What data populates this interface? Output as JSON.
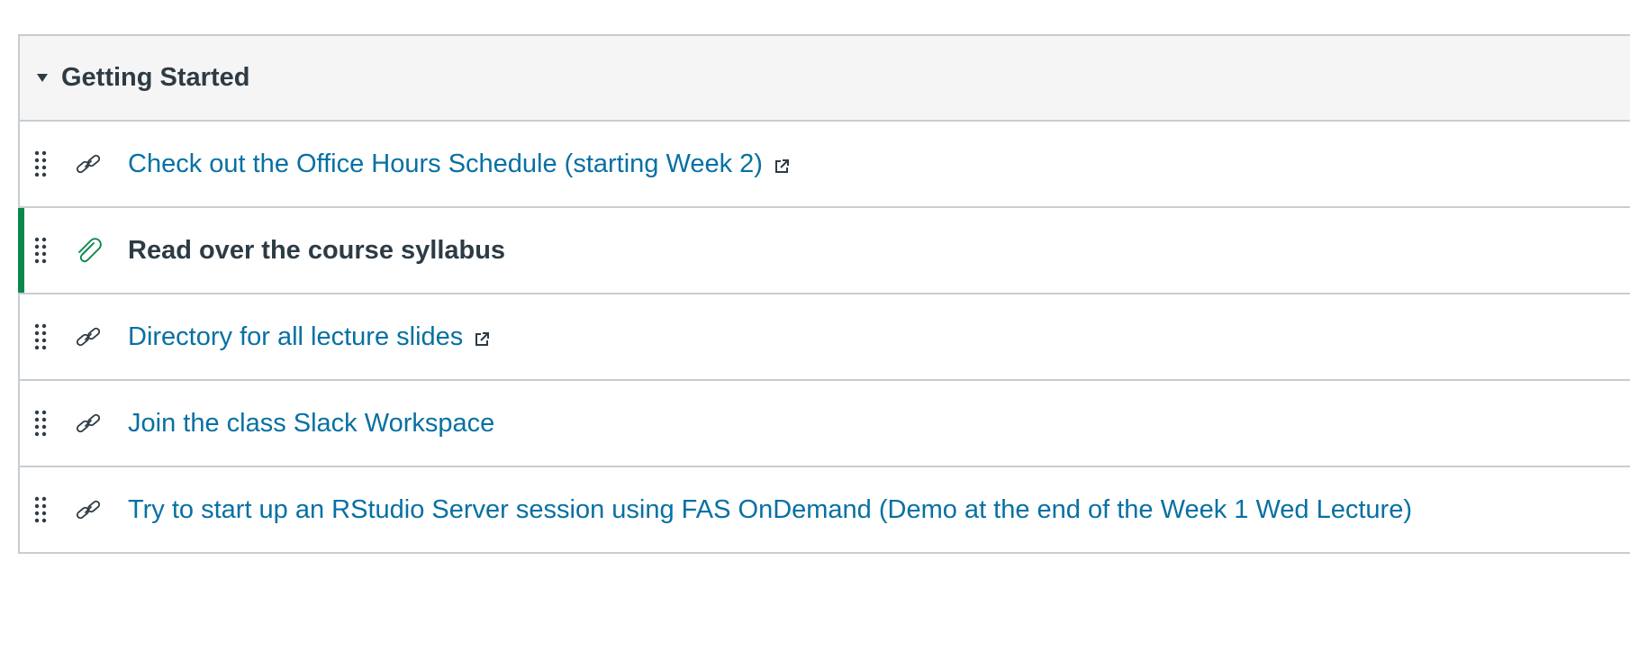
{
  "module": {
    "title": "Getting Started",
    "expanded": true,
    "items": [
      {
        "label": "Check out the Office Hours Schedule (starting Week 2)",
        "type": "external-link",
        "icon": "link-icon",
        "external": true,
        "published_marker": false
      },
      {
        "label": "Read over the course syllabus",
        "type": "attachment",
        "icon": "paperclip-icon",
        "external": false,
        "published_marker": true
      },
      {
        "label": "Directory for all lecture slides",
        "type": "external-link",
        "icon": "link-icon",
        "external": true,
        "published_marker": false
      },
      {
        "label": "Join the class Slack Workspace",
        "type": "external-link",
        "icon": "link-icon",
        "external": false,
        "published_marker": false
      },
      {
        "label": "Try to start up an RStudio Server session using FAS OnDemand (Demo at the end of the Week 1 Wed Lecture)",
        "type": "external-link",
        "icon": "link-icon",
        "external": false,
        "published_marker": false
      }
    ]
  },
  "colors": {
    "link": "#0770a3",
    "text": "#2d3b45",
    "border": "#c7cdd1",
    "header_bg": "#f5f5f5",
    "published": "#0b874b"
  }
}
